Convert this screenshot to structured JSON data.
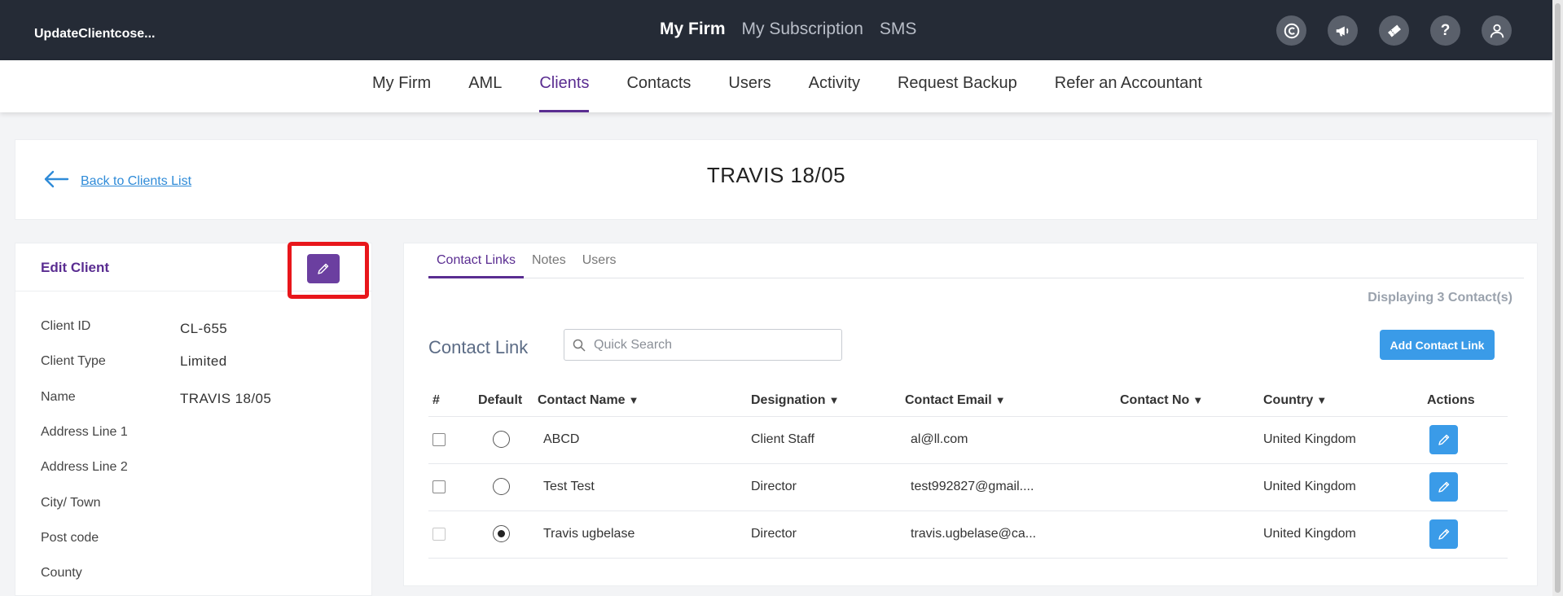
{
  "app": {
    "title": "UpdateClientcose..."
  },
  "topnav": {
    "items": [
      "My Firm",
      "My Subscription",
      "SMS"
    ],
    "active": "My Firm"
  },
  "top_icons": [
    "copyright-icon",
    "megaphone-icon",
    "ticket-icon",
    "help-icon",
    "user-icon"
  ],
  "top_icon_glyphs": {
    "help": "?"
  },
  "subnav": {
    "items": [
      "My Firm",
      "AML",
      "Clients",
      "Contacts",
      "Users",
      "Activity",
      "Request Backup",
      "Refer an Accountant"
    ],
    "active": "Clients"
  },
  "header": {
    "back_label": "Back to Clients List",
    "title": "TRAVIS 18/05"
  },
  "edit_client": {
    "title": "Edit Client",
    "fields": [
      {
        "label": "Client ID",
        "value": "CL-655"
      },
      {
        "label": "Client Type",
        "value": "Limited"
      },
      {
        "label": "Name",
        "value": "TRAVIS 18/05"
      },
      {
        "label": "Address Line 1",
        "value": ""
      },
      {
        "label": "Address Line 2",
        "value": ""
      },
      {
        "label": "City/ Town",
        "value": ""
      },
      {
        "label": "Post code",
        "value": ""
      },
      {
        "label": "County",
        "value": ""
      }
    ]
  },
  "tabs": {
    "items": [
      "Contact Links",
      "Notes",
      "Users"
    ],
    "active": "Contact Links"
  },
  "contact_links": {
    "display_count": "Displaying 3 Contact(s)",
    "title": "Contact Link",
    "search_placeholder": "Quick Search",
    "add_button": "Add Contact Link",
    "arrow_glyph": "▼",
    "columns": [
      "#",
      "Default",
      "Contact Name",
      "Designation",
      "Contact Email",
      "Contact No",
      "Country",
      "Actions"
    ],
    "rows": [
      {
        "default": false,
        "name": "ABCD",
        "designation": "Client Staff",
        "email": "al@ll.com",
        "phone": "",
        "country": "United Kingdom"
      },
      {
        "default": false,
        "name": "Test Test",
        "designation": "Director",
        "email": "test992827@gmail....",
        "phone": "",
        "country": "United Kingdom"
      },
      {
        "default": true,
        "name": "Travis ugbelase",
        "designation": "Director",
        "email": "travis.ugbelase@ca...",
        "phone": "",
        "country": "United Kingdom"
      }
    ]
  },
  "colors": {
    "topbar": "#252b36",
    "accent": "#5a2d91",
    "primary_button": "#3a9be8",
    "highlight": "#e8161b"
  }
}
